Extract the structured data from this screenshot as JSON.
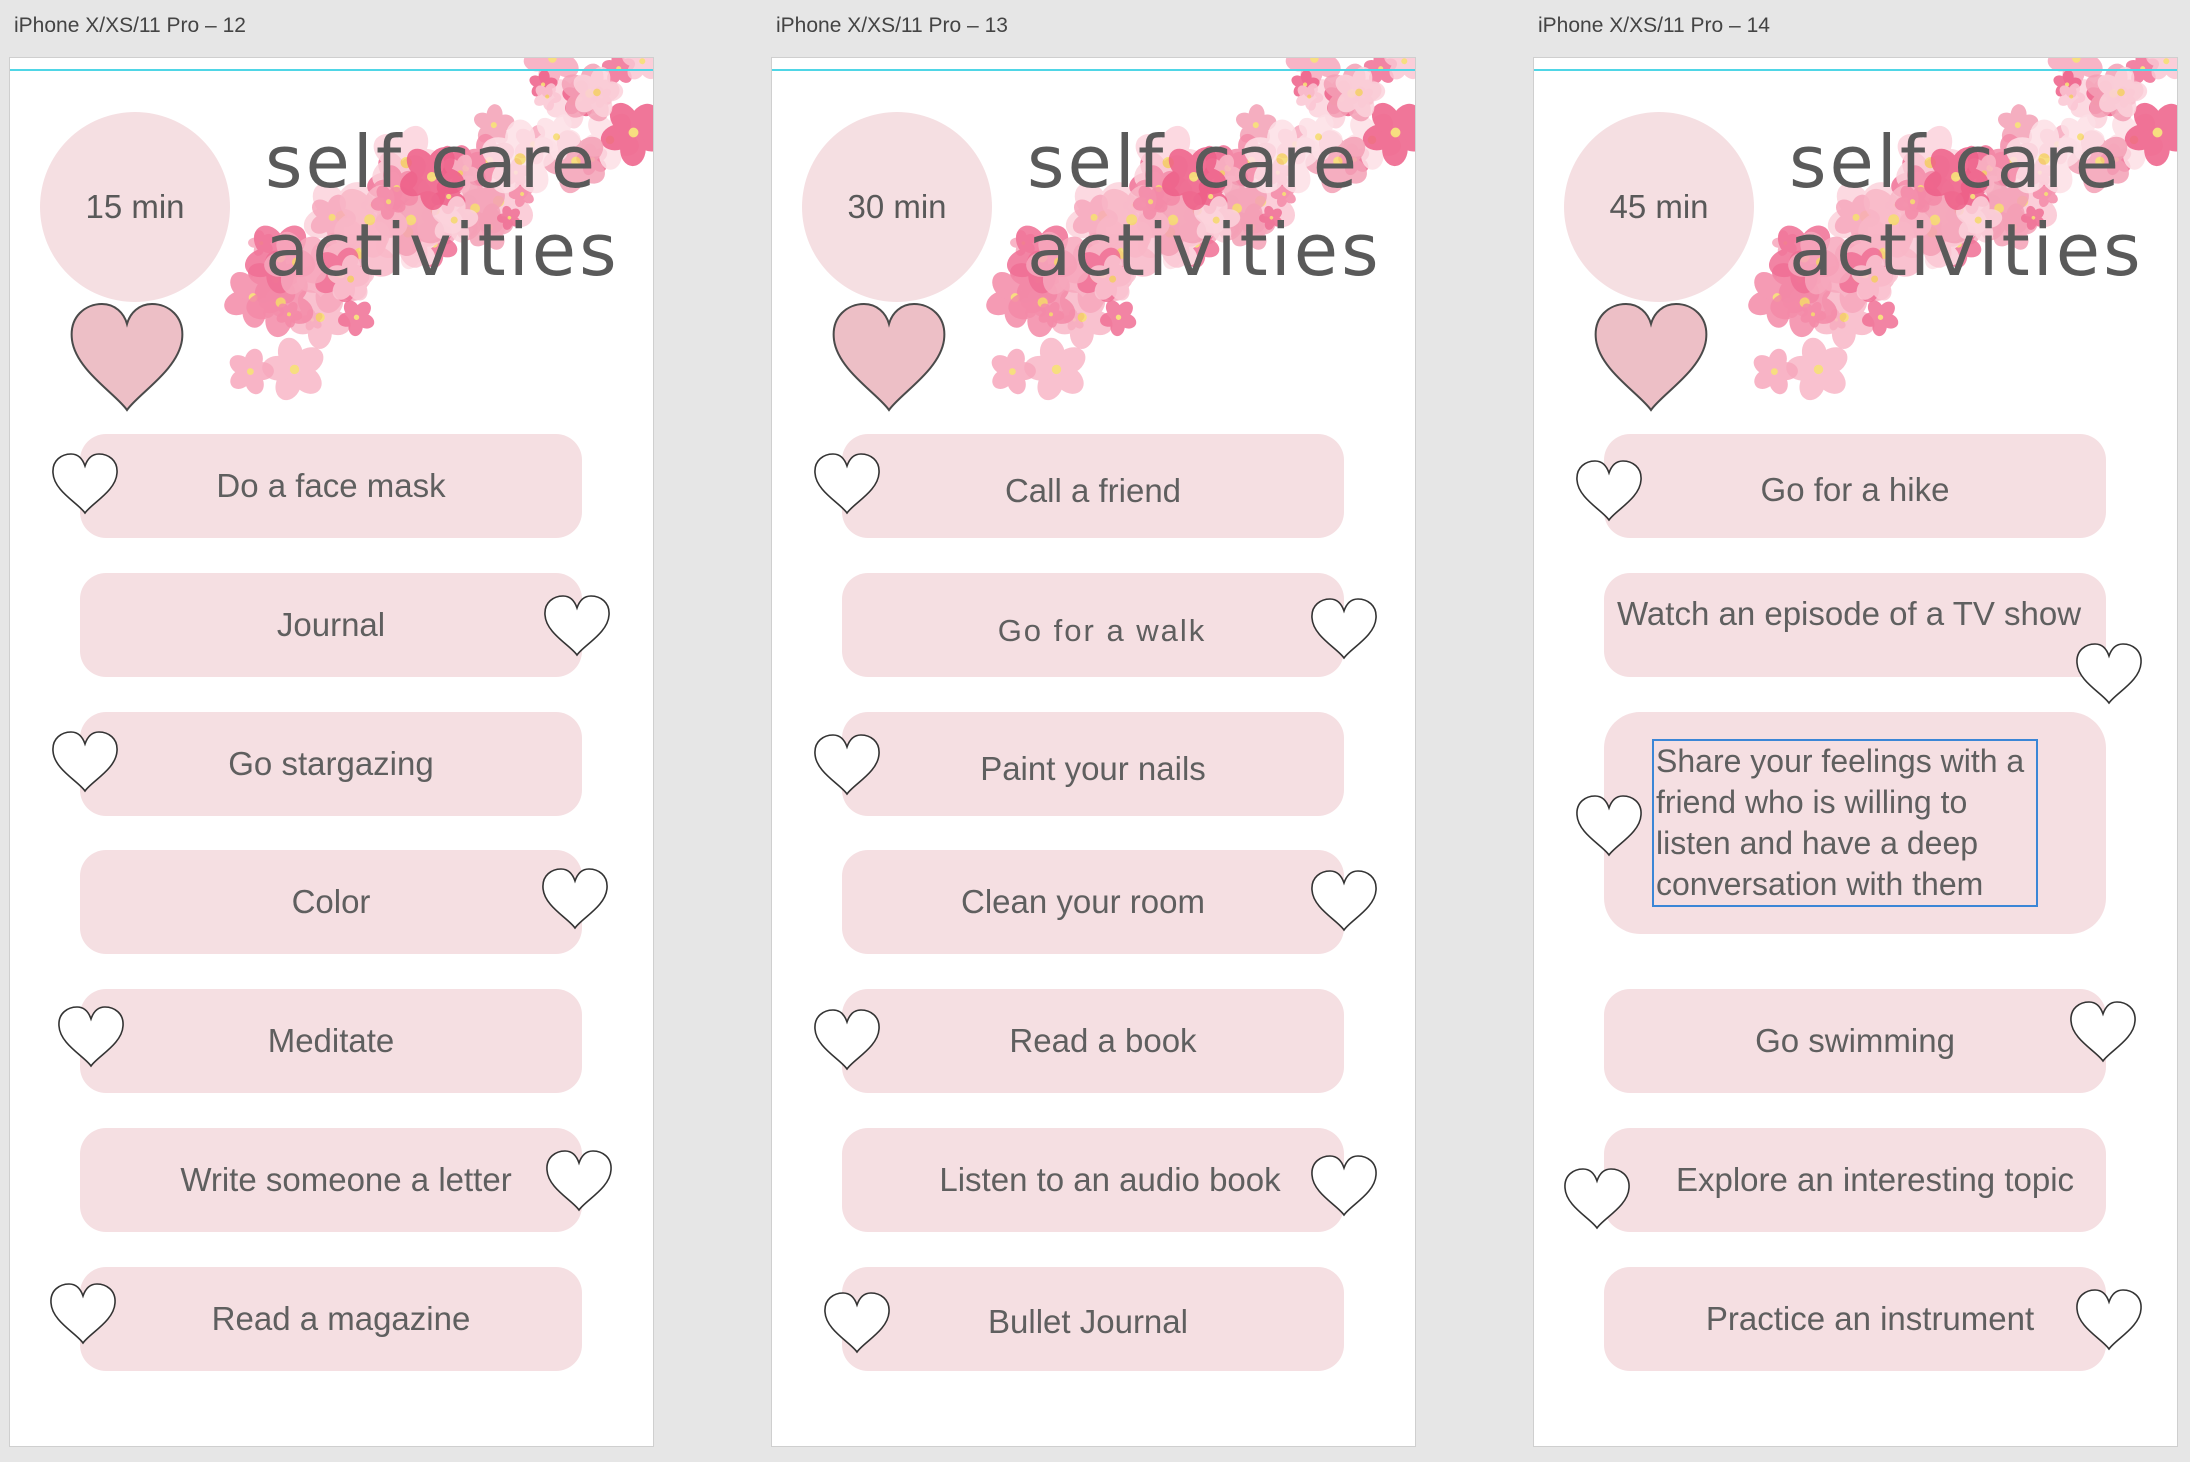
{
  "artboards": [
    {
      "label": "iPhone X/XS/11 Pro – 12",
      "time": "15 min",
      "title_line1": "self care",
      "title_line2": "activities",
      "items": [
        {
          "text": "Do a face mask"
        },
        {
          "text": "Journal"
        },
        {
          "text": "Go stargazing"
        },
        {
          "text": "Color"
        },
        {
          "text": "Meditate"
        },
        {
          "text": "Write someone a letter"
        },
        {
          "text": "Read a magazine"
        }
      ]
    },
    {
      "label": "iPhone X/XS/11 Pro – 13",
      "time": "30 min",
      "title_line1": "self care",
      "title_line2": "activities",
      "items": [
        {
          "text": "Call a friend"
        },
        {
          "text": "Go for a walk"
        },
        {
          "text": "Paint your nails"
        },
        {
          "text": "Clean your room"
        },
        {
          "text": "Read a book"
        },
        {
          "text": "Listen to an audio book"
        },
        {
          "text": "Bullet Journal"
        }
      ]
    },
    {
      "label": "iPhone X/XS/11 Pro – 14",
      "time": "45 min",
      "title_line1": "self care",
      "title_line2": "activities",
      "items": [
        {
          "text": "Go for a hike"
        },
        {
          "text": "Watch an episode of a TV show"
        },
        {
          "text": "Share your feelings with a friend who is willing to listen and have a deep conversation with them"
        },
        {
          "text": "Go swimming"
        },
        {
          "text": "Explore an interesting topic"
        },
        {
          "text": "Practice an instrument"
        }
      ]
    }
  ],
  "colors": {
    "pill": "#f5dfe2",
    "big_heart": "#edbfc6",
    "text": "#5f5f5f",
    "guide": "#4fd6e6",
    "selection": "#3b86d6"
  },
  "icons": {
    "big_heart": "filled-heart-icon",
    "small_heart": "outline-heart-icon",
    "decoration": "watercolor-flowers"
  }
}
